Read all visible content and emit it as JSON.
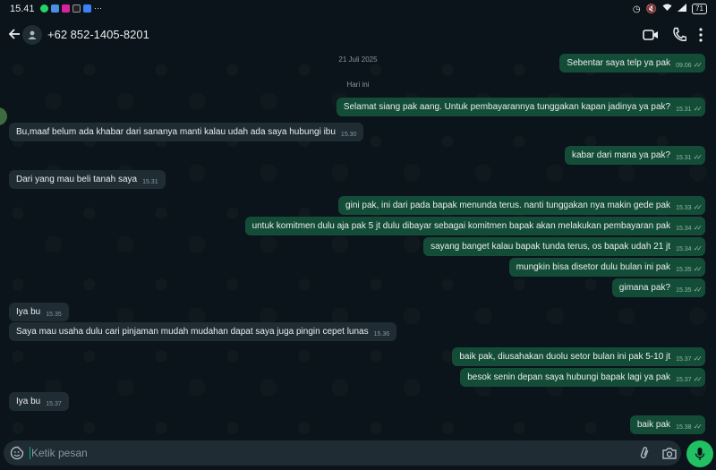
{
  "status_bar": {
    "time": "15.41",
    "icons_left": [
      "whatsapp-icon",
      "files-icon",
      "instagram-icon",
      "tiktok-icon",
      "chat-icon"
    ],
    "more": "···",
    "battery": "71"
  },
  "header": {
    "contact_name": "+62 852-1405-8201"
  },
  "chat": {
    "date_divider": "21 Juli 2025",
    "today_divider": "Hari ini",
    "messages": [
      {
        "dir": "out",
        "text": "Sebentar saya telp ya pak",
        "time": "09.06"
      },
      {
        "dir": "out",
        "text": "Selamat siang pak aang. Untuk pembayarannya tunggakan kapan jadinya ya pak?",
        "time": "15.31"
      },
      {
        "dir": "in",
        "text": "Bu,maaf belum ada khabar dari sananya manti kalau udah ada saya hubungi ibu",
        "time": "15.30"
      },
      {
        "dir": "out",
        "text": "kabar dari mana ya pak?",
        "time": "15.31"
      },
      {
        "dir": "in",
        "text": "Dari yang mau beli tanah saya",
        "time": "15.31"
      },
      {
        "dir": "out",
        "text": "gini pak, ini dari pada bapak menunda terus. nanti tunggakan nya makin gede pak",
        "time": "15.33"
      },
      {
        "dir": "out",
        "text": "untuk komitmen dulu aja pak 5 jt dulu dibayar sebagai komitmen bapak akan melakukan pembayaran pak",
        "time": "15.34"
      },
      {
        "dir": "out",
        "text": "sayang banget kalau bapak tunda terus, os bapak udah 21 jt",
        "time": "15.34"
      },
      {
        "dir": "out",
        "text": "mungkin bisa disetor dulu bulan ini pak",
        "time": "15.35"
      },
      {
        "dir": "out",
        "text": "gimana pak?",
        "time": "15.35"
      },
      {
        "dir": "in",
        "text": "Iya bu",
        "time": "15.35"
      },
      {
        "dir": "in",
        "text": "Saya mau usaha dulu cari pinjaman mudah mudahan dapat saya juga pingin cepet lunas",
        "time": "15.36"
      },
      {
        "dir": "out",
        "text": "baik pak, diusahakan duolu setor bulan ini pak 5-10 jt",
        "time": "15.37"
      },
      {
        "dir": "out",
        "text": "besok senin depan saya hubungi bapak lagi ya pak",
        "time": "15.37"
      },
      {
        "dir": "in",
        "text": "Iya bu",
        "time": "15.37"
      },
      {
        "dir": "out",
        "text": "baik pak",
        "time": "15.38"
      }
    ]
  },
  "composer": {
    "placeholder": "Ketik pesan"
  },
  "colors": {
    "background": "#0b141a",
    "outgoing_bubble": "#144d37",
    "incoming_bubble": "#1f2c34",
    "accent": "#21c063"
  }
}
